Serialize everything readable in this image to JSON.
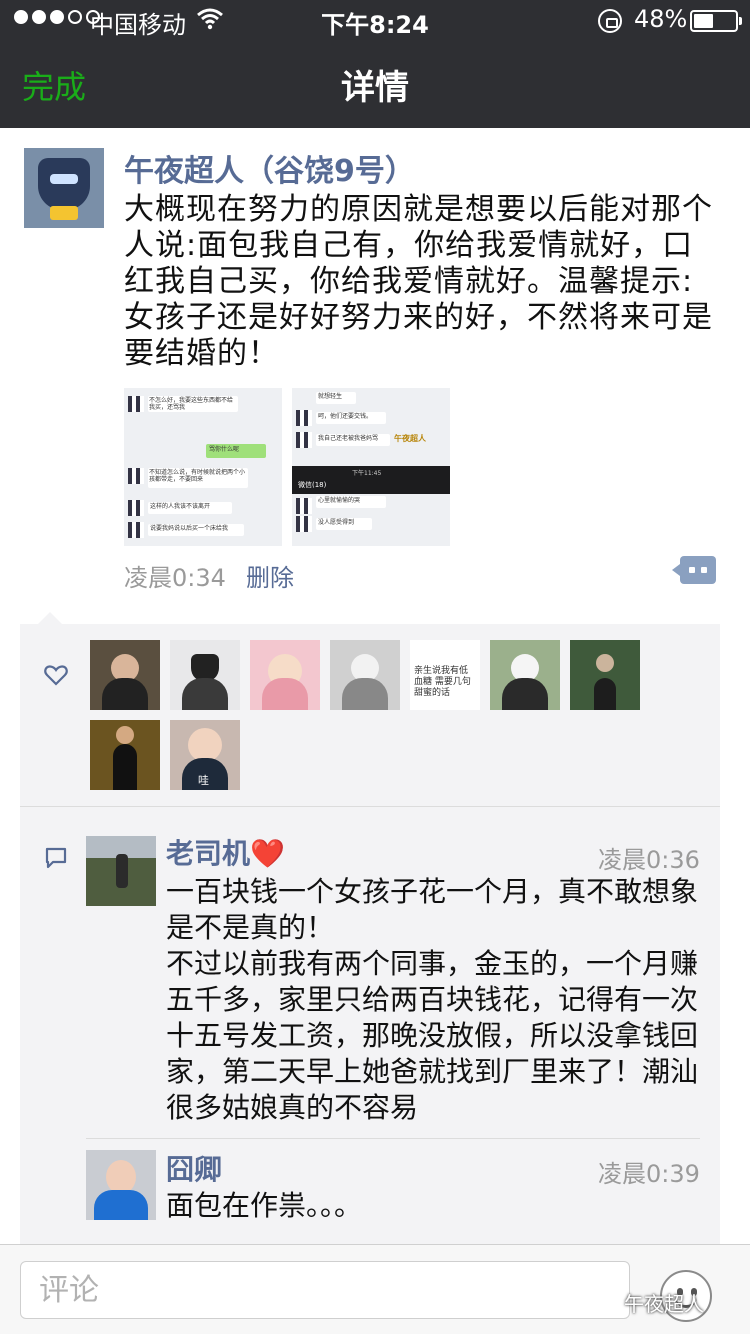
{
  "status_bar": {
    "carrier": "中国移动",
    "time": "下午8:24",
    "battery_text": "48%",
    "battery_level": 0.48,
    "signal_bars_filled": 3,
    "signal_bars_total": 5
  },
  "nav": {
    "done_label": "完成",
    "title": "详情"
  },
  "post": {
    "author": "午夜超人（谷饶9号）",
    "text": "大概现在努力的原因就是想要以后能对那个人说:面包我自己有，你给我爱情就好，口红我自己买，你给我爱情就好。温馨提示:女孩子还是好好努力来的好，不然将来可是要结婚的！",
    "time": "凌晨0:34",
    "delete_label": "删除",
    "image1_lines": [
      "不怎么好，我要这些东西都不给我买，还骂我",
      "骂你什么呢",
      "不知道怎么说，有时候就说把两个小孩都带走，不要回来",
      "这样的人我该不该离开",
      "说要我妈说以后买一个床给我"
    ],
    "image2_lines": [
      "就想轻生",
      "呵，他们还要交钱。",
      "我自己还老被我爸妈骂",
      "午夜超人",
      "微信(18)",
      "心里就愉愉的哭",
      "没人愿受得到"
    ],
    "image2_status_time": "下午11:45"
  },
  "likes": {
    "text_avatar": "亲生说我有低血糖 需要几句甜蜜的话",
    "wa_label": "哇"
  },
  "comments": [
    {
      "name": "老司机❤️",
      "time": "凌晨0:36",
      "text": "一百块钱一个女孩子花一个月，真不敢想象是不是真的！\n不过以前我有两个同事，金玉的，一个月赚五千多，家里只给两百块钱花，记得有一次十五号发工资，那晚没放假，所以没拿钱回家，第二天早上她爸就找到厂里来了！潮汕很多姑娘真的不容易"
    },
    {
      "name": "囧卿",
      "time": "凌晨0:39",
      "text": "面包在作祟。。。"
    }
  ],
  "input": {
    "placeholder": "评论"
  },
  "watermark": "午夜超人",
  "colors": {
    "accent_green": "#1aad19",
    "link_blue": "#576b95",
    "nav_bg": "#2e2f33"
  }
}
